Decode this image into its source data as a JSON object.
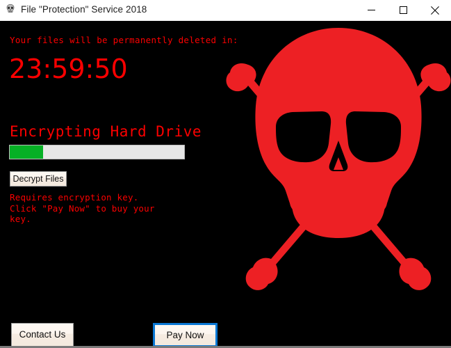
{
  "window": {
    "title": "File \"Protection\" Service 2018",
    "icon": "skull-icon",
    "controls": {
      "minimize": "minimize-icon",
      "maximize": "maximize-icon",
      "close": "close-icon"
    }
  },
  "ransom": {
    "warning": "Your files will be permanently deleted in:",
    "countdown": "23:59:50",
    "status_heading": "Encrypting Hard Drive",
    "progress_percent": 19,
    "decrypt_label": "Decrypt Files",
    "requires_key_text": "Requires encryption key.\nClick \"Pay Now\" to buy your\nkey.",
    "contact_label": "Contact Us",
    "pay_label": "Pay Now"
  },
  "artwork": {
    "name": "skull-and-crossbones",
    "color": "#ed2024"
  },
  "colors": {
    "background": "#000000",
    "text_red": "#fb0000",
    "skull_red": "#ed2024",
    "progress_fill": "#06b025",
    "progress_track": "#e6e6e6",
    "focus_blue": "#0a78d4",
    "titlebar": "#ffffff"
  }
}
